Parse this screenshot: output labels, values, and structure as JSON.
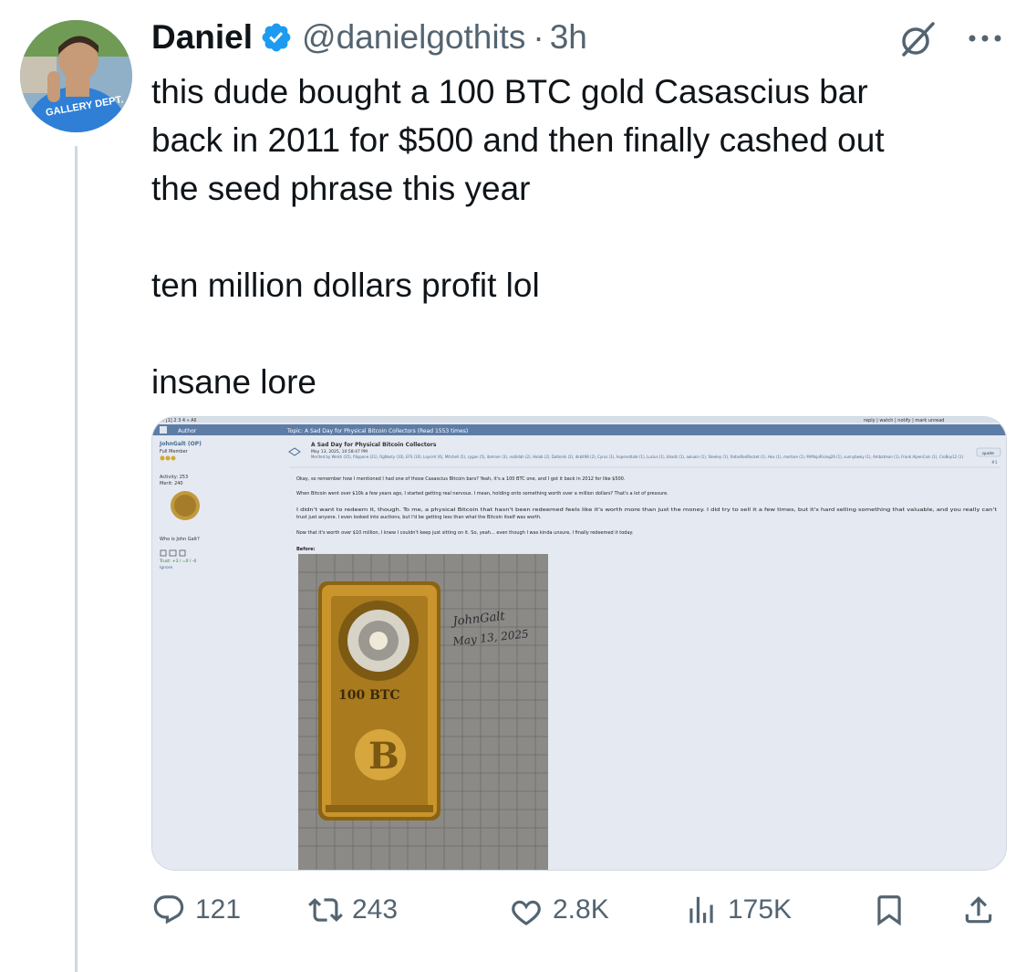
{
  "author": {
    "name": "Daniel",
    "handle": "@danielgothits",
    "separator": "·",
    "time": "3h",
    "avatar_text": "GALLERY DEPT."
  },
  "tweet": {
    "lines": [
      "this dude bought a 100 BTC gold Casascius bar",
      "back in 2011 for $500 and then finally cashed out",
      "the seed phrase this year",
      "",
      "ten million dollars profit lol",
      "",
      "insane lore"
    ]
  },
  "embedded": {
    "pager": "« [1] 2 3 4 » All",
    "col_author": "Author",
    "topic": "Topic: A Sad Day for Physical Bitcoin Collectors (Read 1553 times)",
    "top_links": "reply | watch | notify | mark unread",
    "user": "JohnGalt (OP)",
    "rank": "Full Member",
    "activity": "Activity: 253",
    "merit": "Merit: 240",
    "who": "Who is John Galt?",
    "trust": "Trust: +3 / =0 / -0",
    "ignore": "Ignore",
    "post_title": "A Sad Day for Physical Bitcoin Collectors",
    "post_date": "May 13, 2025, 10:58:47 PM",
    "merited": "Merited by Welsh (35), filippone (21), OgNasty (10), EFS (10), LoyceV (6), Mitchell (5), cygan (5), ibminer (3), nutildah (2), Halab (2), Daltonik (2), dkbit98 (2), Cyrus (1), hopenotlate (1), Lucius (1), bhadz (1), aoluain (1), Steeley (1), YodasRedRocket (1), Hox (1), mortare (1), MrMojoRising26 (1), sunnybwoy (1), Ambatman (1), Frank AlpenCoin (1), CroBoy12 (1)",
    "quote": "quote",
    "post_num": "#1",
    "p1": "Okay, so remember how I mentioned I had one of those Casascius Bitcoin bars? Yeah, it's a 100 BTC one, and I got it back in 2012 for like $500.",
    "p2": "When Bitcoin went over $10k a few years ago, I started getting real nervous. I mean, holding onto something worth over a million dollars? That's a lot of pressure.",
    "p3": "I didn't want to redeem it, though. To me, a physical Bitcoin that hasn't been redeemed feels like it's worth more than just the money. I did try to sell it a few times, but it's hard selling something that valuable, and you really can't",
    "p3b": "trust just anyone. I even looked into auctions, but I'd be getting less than what the Bitcoin itself was worth.",
    "p4": "Now that it's worth over $10 million, I knew I couldn't keep just sitting on it. So, yeah... even though I was kinda unsure, I finally redeemed it today.",
    "before": "Before:",
    "bar_label": "100 BTC",
    "note_line1": "JohnGalt",
    "note_line2": "May 13, 2025"
  },
  "actions": {
    "replies": "121",
    "reposts": "243",
    "likes": "2.8K",
    "views": "175K"
  },
  "colors": {
    "verified": "#1d9bf0",
    "muted": "#536471",
    "forum_bg": "#e5e9f2",
    "forum_header": "#5d7ca6"
  }
}
